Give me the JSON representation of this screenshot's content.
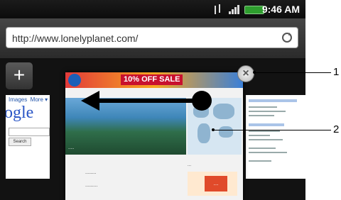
{
  "status_bar": {
    "time": "9:46 AM",
    "icons": [
      "data-sync-icon",
      "signal-icon",
      "battery-icon"
    ],
    "battery_color": "#2e9e2e"
  },
  "url_bar": {
    "url": "http://www.lonelyplanet.com/",
    "refresh_icon": "refresh-icon"
  },
  "tabs": {
    "new_tab_label": "+",
    "main_tab": {
      "sale_banner": "10% OFF SALE"
    },
    "left_tab": {
      "logo_text": "ogle"
    }
  },
  "close_tab": {
    "label": "×"
  },
  "callouts": [
    "1",
    "2"
  ]
}
